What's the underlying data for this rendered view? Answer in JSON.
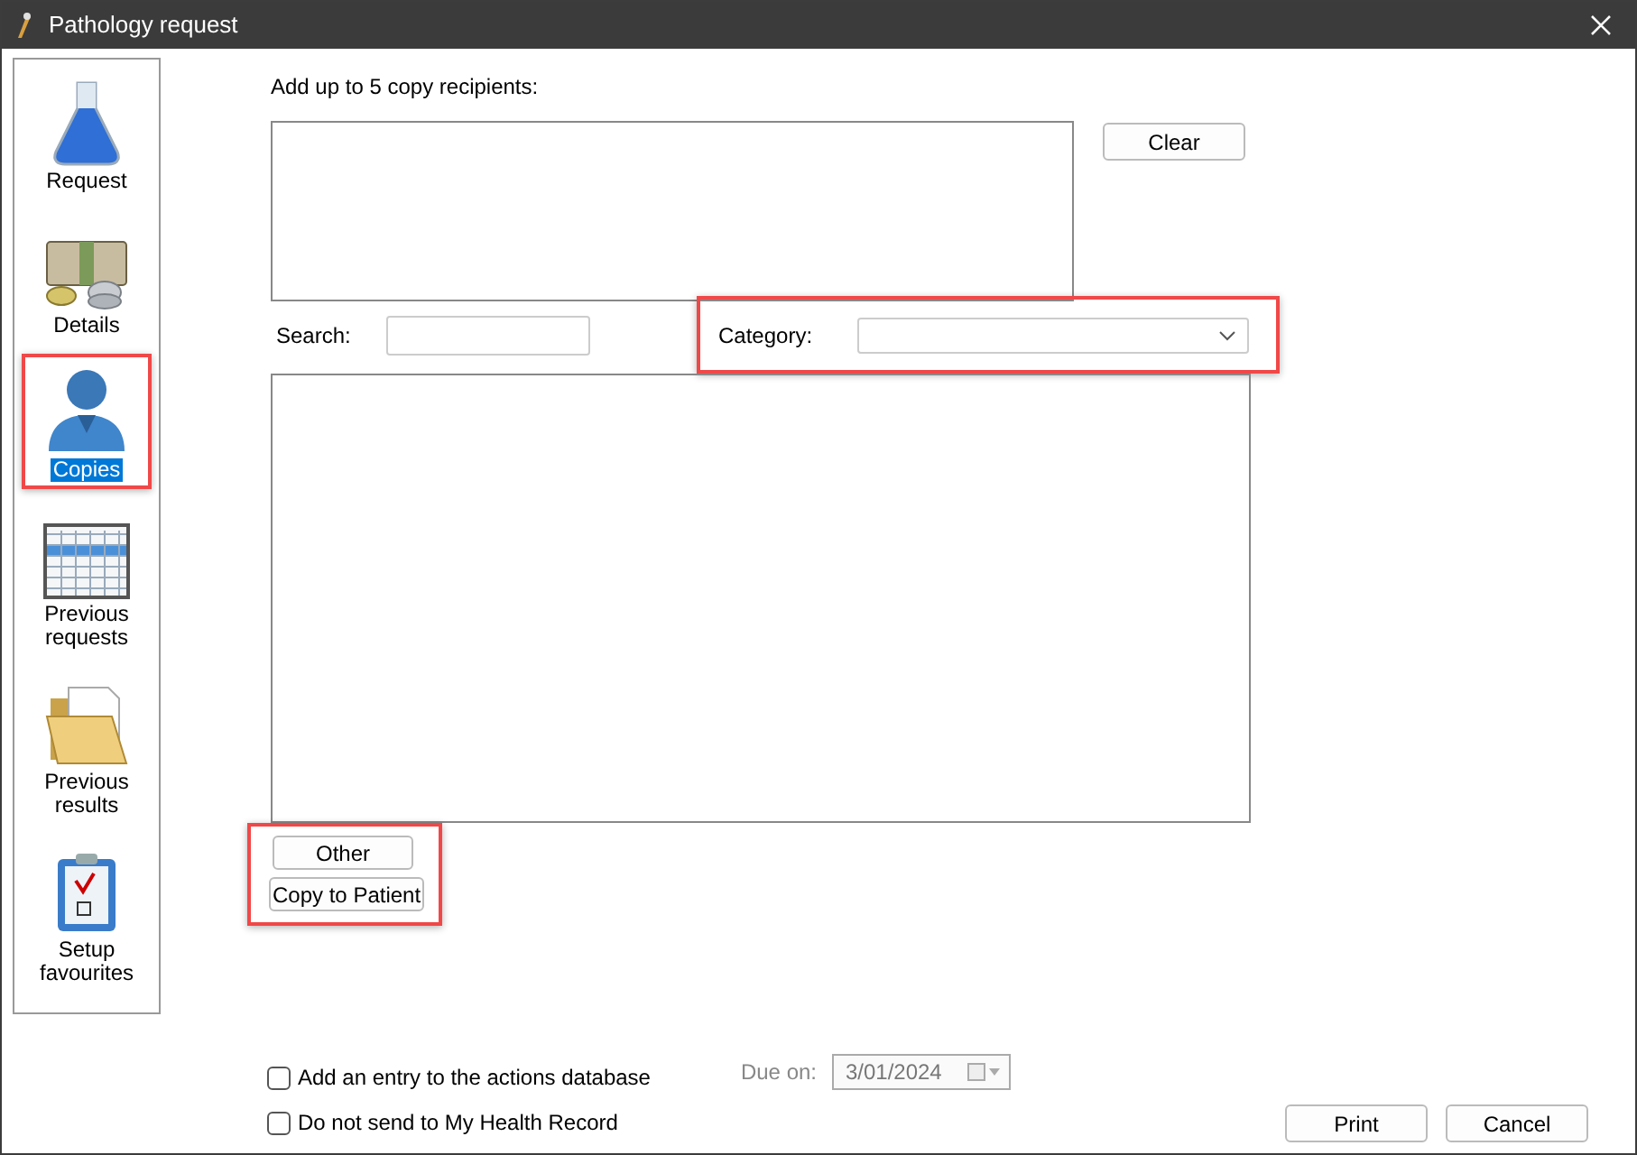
{
  "window": {
    "title": "Pathology request"
  },
  "sidebar": {
    "items": [
      {
        "label": "Request",
        "kind": "flask",
        "selected": false,
        "highlighted": false
      },
      {
        "label": "Details",
        "kind": "money",
        "selected": false,
        "highlighted": false
      },
      {
        "label": "Copies",
        "kind": "doctor",
        "selected": true,
        "highlighted": true
      },
      {
        "label": "Previous requests",
        "kind": "calendar",
        "selected": false,
        "highlighted": false
      },
      {
        "label": "Previous results",
        "kind": "folder",
        "selected": false,
        "highlighted": false
      },
      {
        "label": "Setup favourites",
        "kind": "clipboard",
        "selected": false,
        "highlighted": false
      }
    ]
  },
  "recipients": {
    "label": "Add up to 5 copy recipients:",
    "clear_button": "Clear"
  },
  "search": {
    "label": "Search:"
  },
  "category": {
    "label": "Category:",
    "highlighted": true
  },
  "copy_buttons": {
    "highlighted": true,
    "buttons": [
      "Other",
      "Copy to Patient"
    ]
  },
  "options": [
    {
      "label": "Add an entry to the actions database",
      "checked": false
    },
    {
      "label": "Do not send to My Health Record",
      "checked": false
    }
  ],
  "due": {
    "label": "Due on:",
    "value": "3/01/2024",
    "disabled": true
  },
  "buttons": [
    "Print",
    "Cancel"
  ]
}
